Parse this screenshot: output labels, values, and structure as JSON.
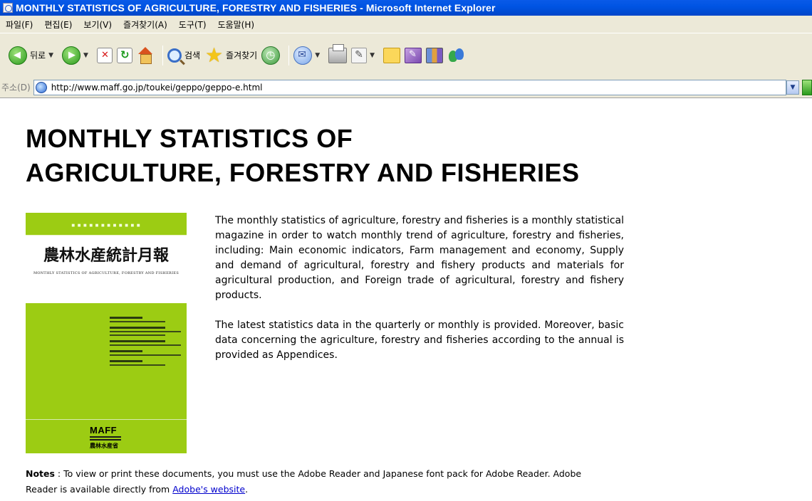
{
  "window": {
    "title": "MONTHLY STATISTICS OF AGRICULTURE, FORESTRY AND FISHERIES - Microsoft Internet Explorer"
  },
  "menu": {
    "items": [
      "파일(F)",
      "편집(E)",
      "보기(V)",
      "즐겨찾기(A)",
      "도구(T)",
      "도움말(H)"
    ]
  },
  "toolbar": {
    "back_label": "뒤로",
    "search_label": "검색",
    "favorites_label": "즐겨찾기"
  },
  "address": {
    "label": "주소(D)",
    "url": "http://www.maff.go.jp/toukei/geppo/geppo-e.html"
  },
  "page": {
    "title_line1": "MONTHLY STATISTICS OF",
    "title_line2": "AGRICULTURE, FORESTRY AND FISHERIES",
    "cover": {
      "jp_title": "農林水産統計月報",
      "en_subtitle": "MONTHLY STATISTICS OF AGRICULTURE, FORESTRY AND FISHERIES",
      "publisher": "MAFF",
      "publisher_jp": "農林水産省"
    },
    "description": [
      "The monthly statistics of agriculture, forestry and fisheries is a monthly statistical magazine in order to watch monthly trend of agriculture, forestry and fisheries, including: Main economic indicators, Farm management and economy, Supply and demand of agricultural, forestry and fishery products and materials for agricultural production, and Foreign trade of agricultural, forestry and fishery products.",
      "The latest statistics data in the quarterly or monthly is provided. Moreover, basic data concerning the agriculture, forestry and fisheries according to the annual is provided as Appendices."
    ],
    "notes": {
      "label": "Notes",
      "sep": " : ",
      "text": "To view or print these documents, you must use the Adobe Reader and Japanese font pack for Adobe Reader. Adobe Reader is available directly from ",
      "link_text": "Adobe's website",
      "end": "."
    }
  },
  "colors": {
    "titlebar": "#0054e3",
    "chrome": "#ece9d8",
    "cover_green": "#9ccc13",
    "link": "#0000cc"
  }
}
